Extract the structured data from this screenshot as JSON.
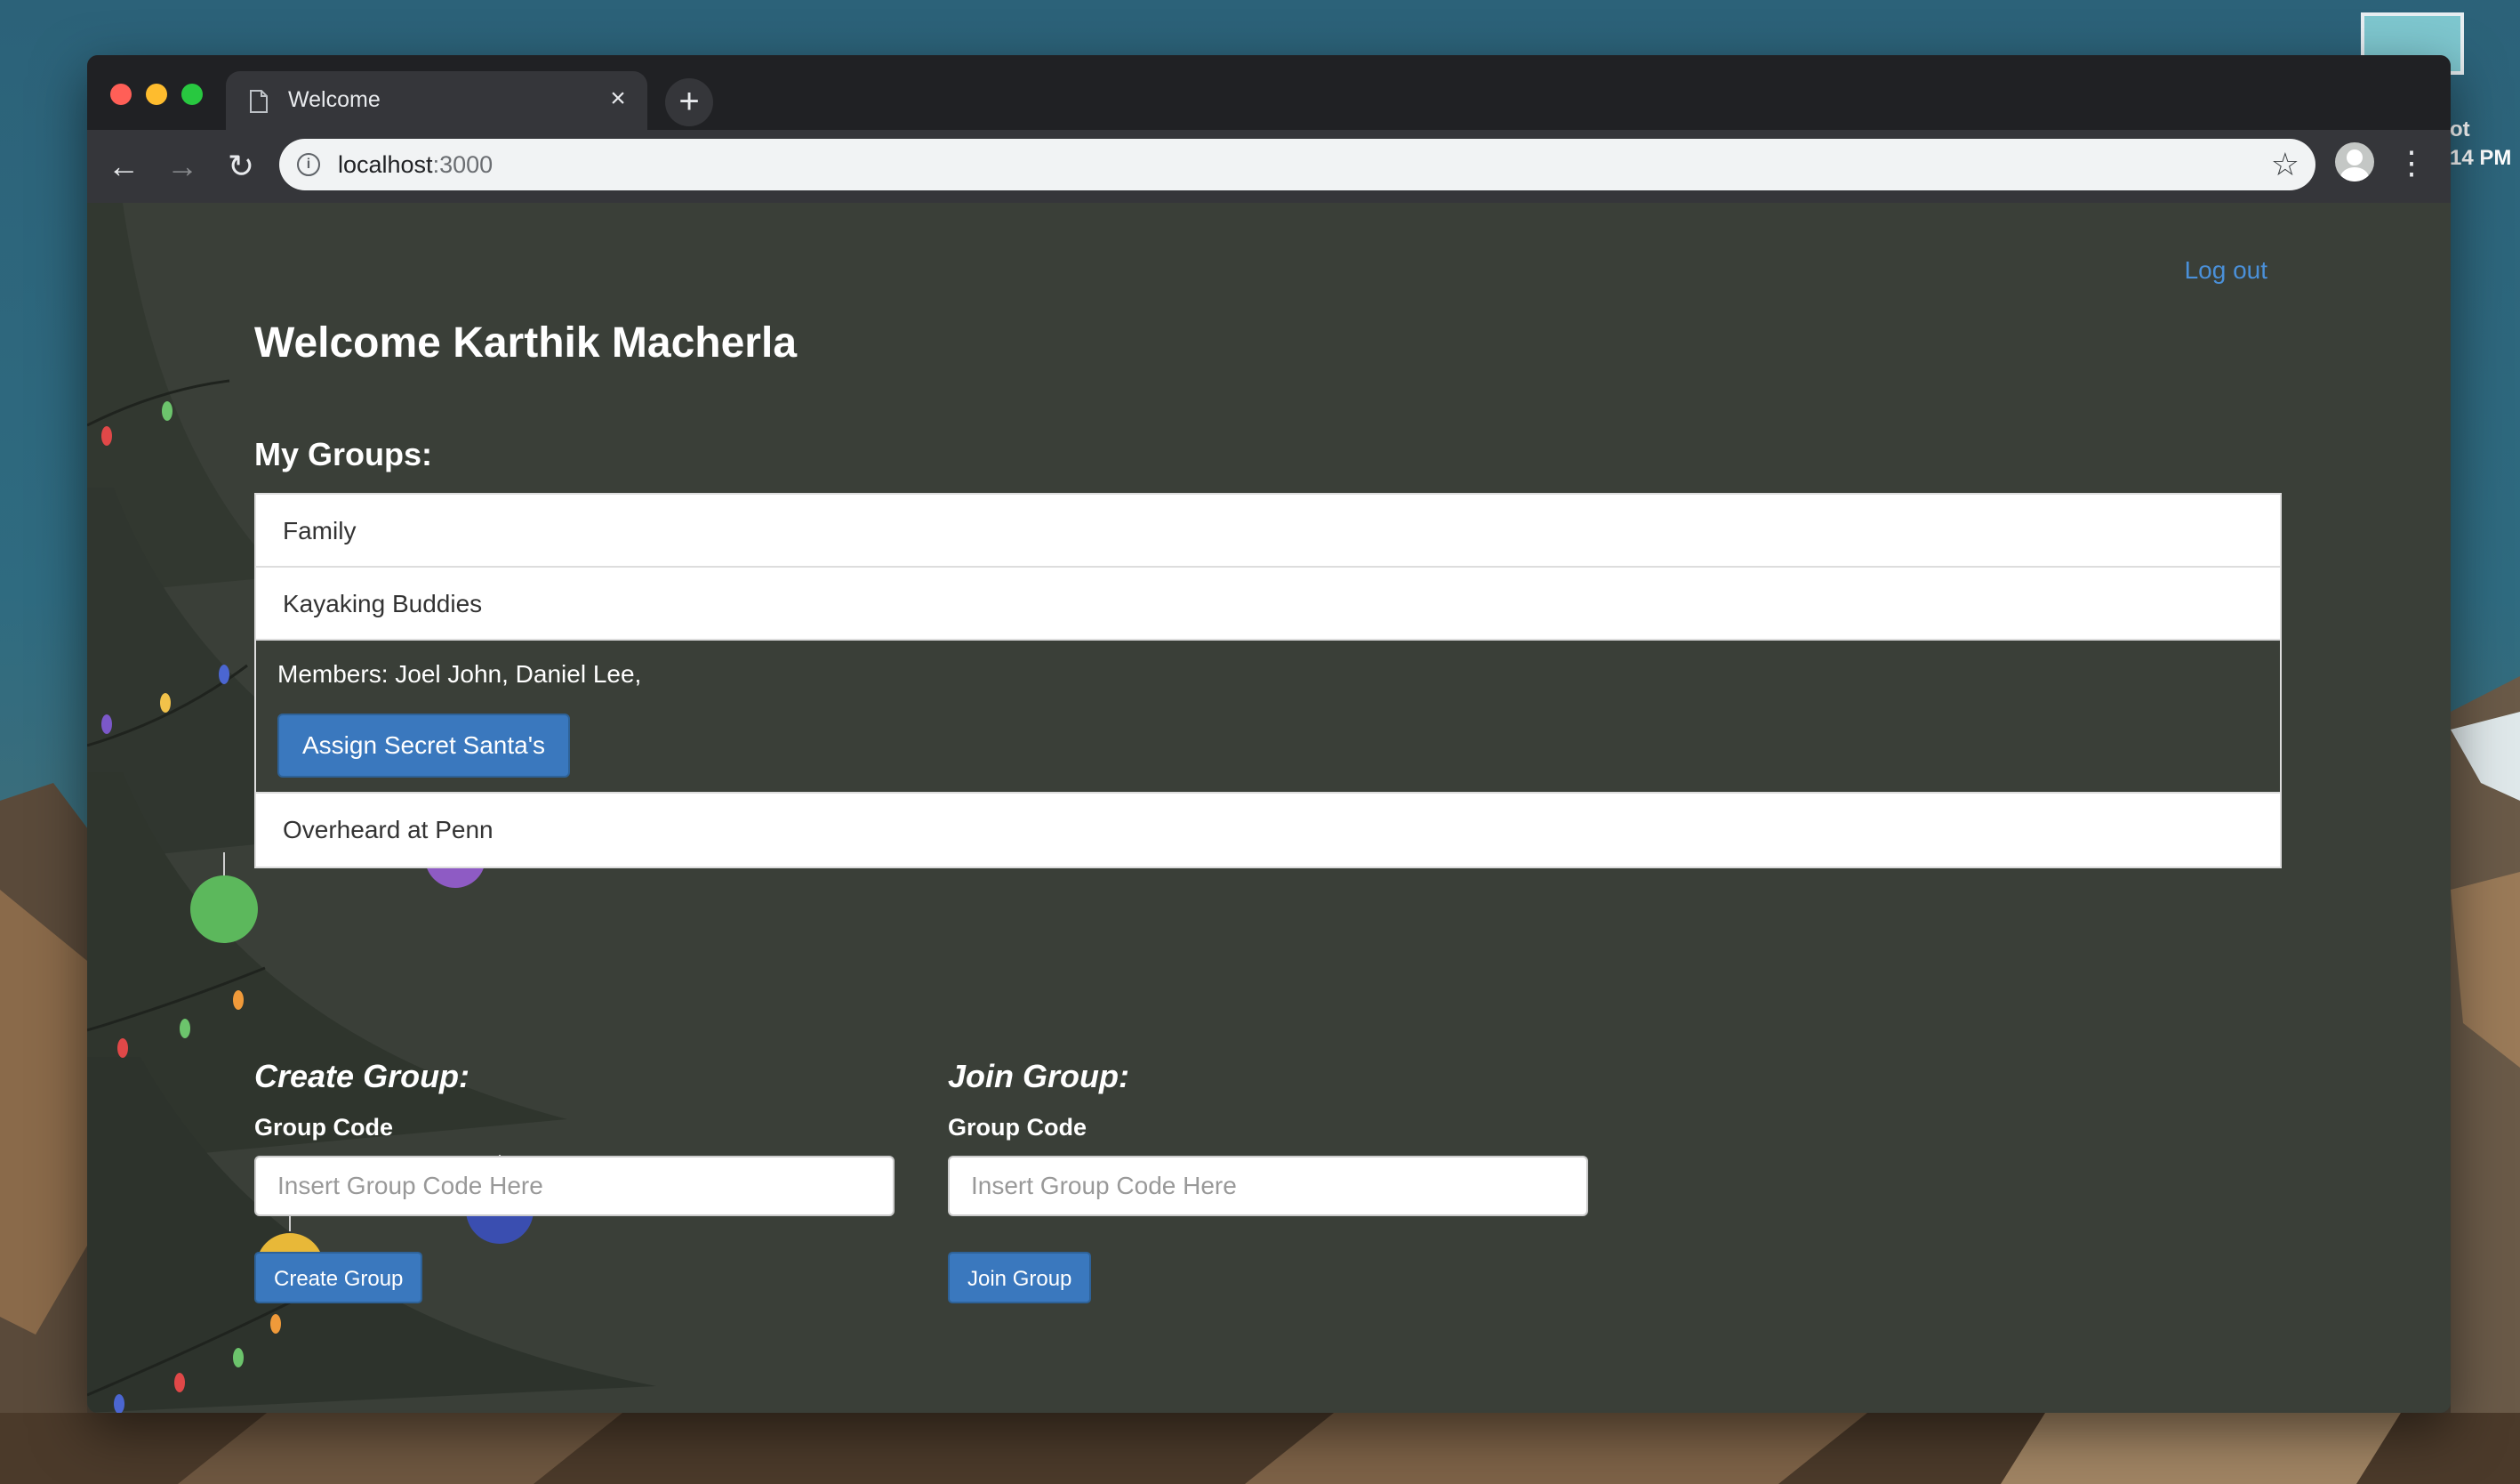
{
  "desktop": {
    "label_line1": "ot",
    "label_line2": "14 PM"
  },
  "browser": {
    "tab_title": "Welcome",
    "url_host": "localhost",
    "url_port": ":3000",
    "icons": {
      "tab": "page-icon",
      "close": "close-icon",
      "new_tab": "plus-icon",
      "back": "back-arrow-icon",
      "forward": "forward-arrow-icon",
      "reload": "reload-icon",
      "info": "info-icon",
      "bookmark": "star-icon",
      "profile": "avatar-icon",
      "menu": "kebab-menu-icon"
    }
  },
  "page": {
    "logout_label": "Log out",
    "welcome": "Welcome Karthik Macherla",
    "my_groups_title": "My Groups:",
    "groups": [
      {
        "name": "Family"
      },
      {
        "name": "Kayaking Buddies"
      },
      {
        "name": "Overheard at Penn"
      }
    ],
    "expanded_group": {
      "members": "Members: Joel John, Daniel Lee,",
      "assign_button": "Assign Secret Santa's"
    },
    "create": {
      "title": "Create Group:",
      "label": "Group Code",
      "placeholder": "Insert Group Code Here",
      "button": "Create Group"
    },
    "join": {
      "title": "Join Group:",
      "label": "Group Code",
      "placeholder": "Insert Group Code Here",
      "button": "Join Group"
    }
  },
  "colors": {
    "page_bg": "#3a3f38",
    "accent_button": "#3a78be",
    "link": "#4a90d9"
  }
}
